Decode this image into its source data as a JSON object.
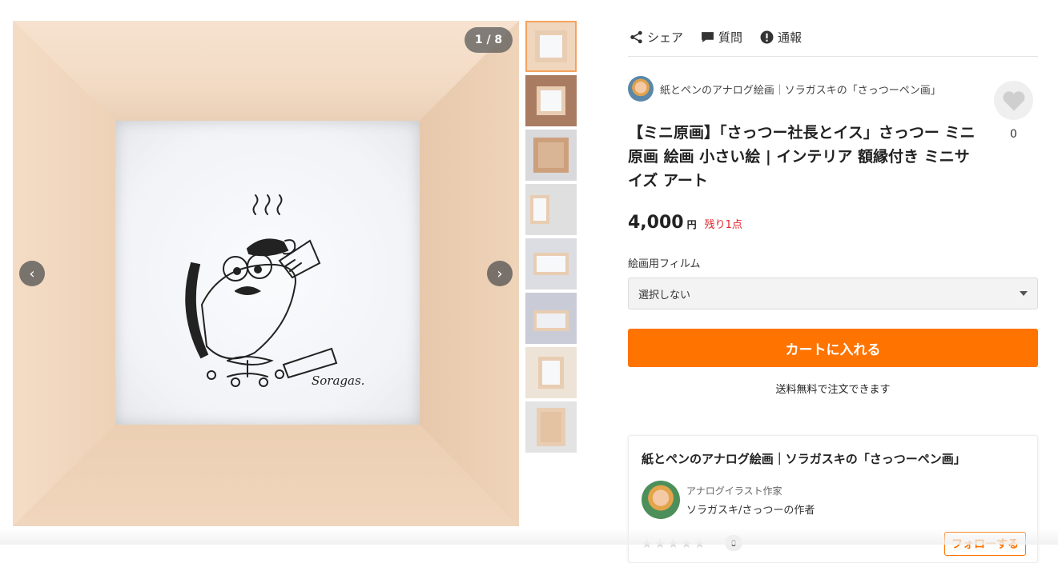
{
  "gallery": {
    "counter": "1 / 8",
    "thumbnail_count": 8,
    "image_signature": "Soragas."
  },
  "actions": {
    "share": "シェア",
    "question": "質問",
    "report": "通報"
  },
  "shop": {
    "name": "紙とペンのアナログ絵画｜ソラガスキの「さっつーペン画」"
  },
  "favorite": {
    "count": "0"
  },
  "product": {
    "title": "【ミニ原画】「さっつー社長とイス」さっつー ミニ原画 絵画 小さい絵 | インテリア 額縁付き ミニサイズ アート",
    "price": "4,000",
    "currency": "円",
    "stock": "残り1点"
  },
  "option": {
    "label": "絵画用フィルム",
    "selected": "選択しない"
  },
  "cart": {
    "button": "カートに入れる",
    "shipping_note": "送料無料で注文できます"
  },
  "shop_card": {
    "title": "紙とペンのアナログ絵画｜ソラガスキの「さっつーペン画」",
    "role": "アナログイラスト作家",
    "artist": "ソラガスキ/さっつーの作者",
    "review_count": "0",
    "follow": "フォローする"
  },
  "colors": {
    "accent": "#ff7300",
    "stock": "#e4232b",
    "active_thumb": "#f5a25d"
  }
}
